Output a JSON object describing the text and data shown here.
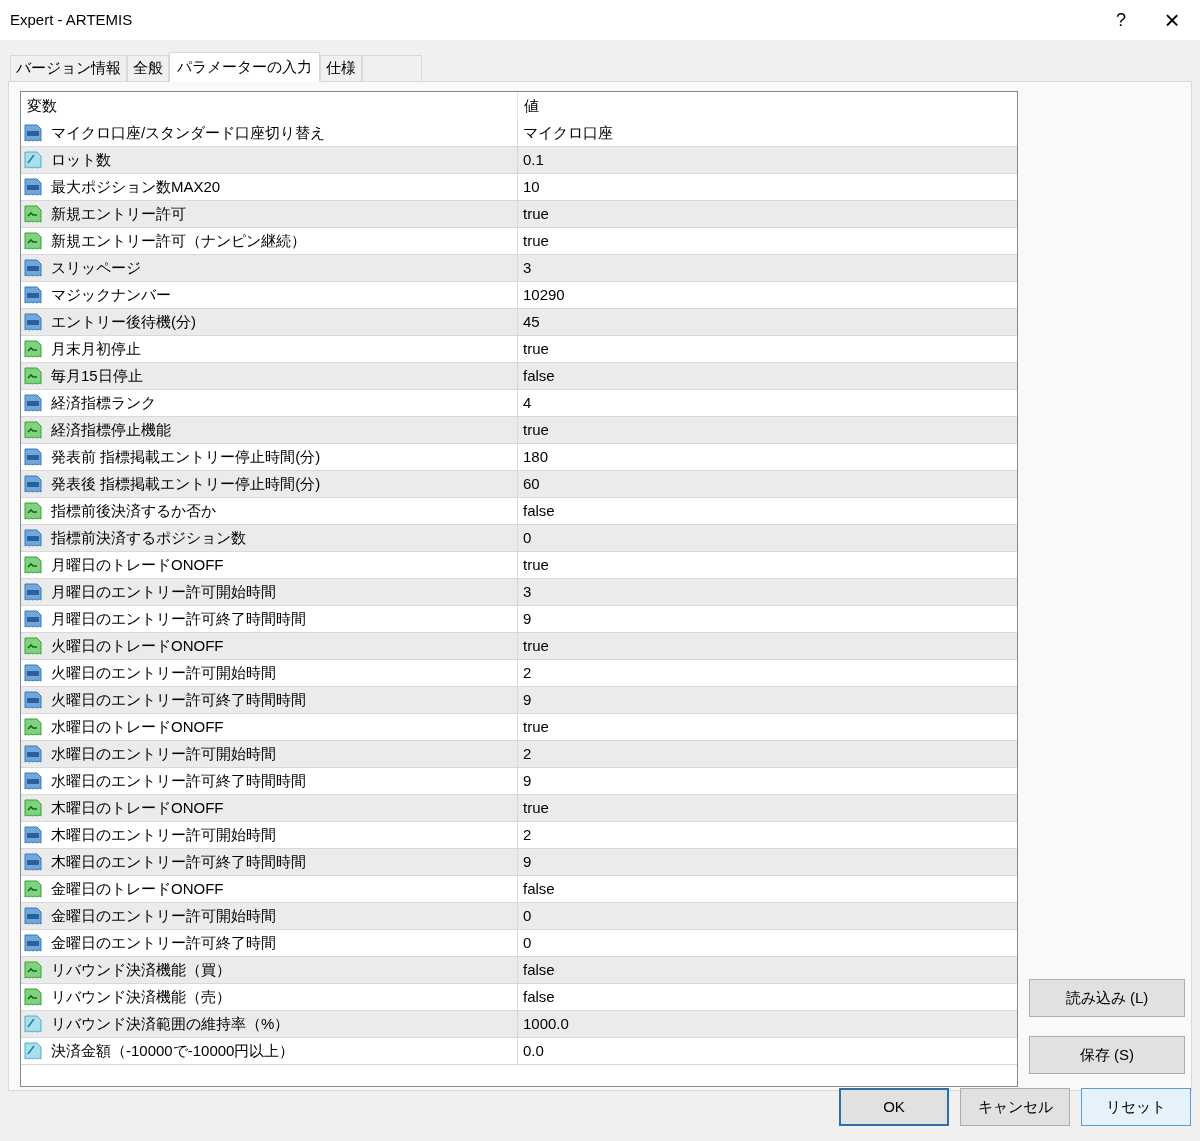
{
  "window": {
    "title": "Expert - ARTEMIS",
    "help": "?",
    "close": "×"
  },
  "tabs": [
    {
      "label": "バージョン情報",
      "selected": false
    },
    {
      "label": "全般",
      "selected": false
    },
    {
      "label": "パラメーターの入力",
      "selected": true
    },
    {
      "label": "仕様",
      "selected": false
    }
  ],
  "table": {
    "columns": [
      "変数",
      "値"
    ],
    "rows": [
      {
        "kind": "int",
        "name": "マイクロ口座/スタンダード口座切り替え",
        "value": "マイクロ口座"
      },
      {
        "kind": "double",
        "name": "ロット数",
        "value": "0.1"
      },
      {
        "kind": "int",
        "name": "最大ポジション数MAX20",
        "value": "10"
      },
      {
        "kind": "bool",
        "name": "新規エントリー許可",
        "value": "true"
      },
      {
        "kind": "bool",
        "name": "新規エントリー許可（ナンピン継続）",
        "value": "true"
      },
      {
        "kind": "int",
        "name": "スリッページ",
        "value": "3"
      },
      {
        "kind": "int",
        "name": "マジックナンバー",
        "value": "10290"
      },
      {
        "kind": "int",
        "name": "エントリー後待機(分)",
        "value": "45"
      },
      {
        "kind": "bool",
        "name": "月末月初停止",
        "value": "true"
      },
      {
        "kind": "bool",
        "name": "毎月15日停止",
        "value": "false"
      },
      {
        "kind": "int",
        "name": "経済指標ランク",
        "value": "4"
      },
      {
        "kind": "bool",
        "name": "経済指標停止機能",
        "value": "true"
      },
      {
        "kind": "int",
        "name": "発表前 指標掲載エントリー停止時間(分)",
        "value": "180"
      },
      {
        "kind": "int",
        "name": "発表後 指標掲載エントリー停止時間(分)",
        "value": "60"
      },
      {
        "kind": "bool",
        "name": "指標前後決済するか否か",
        "value": "false"
      },
      {
        "kind": "int",
        "name": "指標前決済するポジション数",
        "value": "0"
      },
      {
        "kind": "bool",
        "name": "月曜日のトレードONOFF",
        "value": "true"
      },
      {
        "kind": "int",
        "name": "月曜日のエントリー許可開始時間",
        "value": "3"
      },
      {
        "kind": "int",
        "name": "月曜日のエントリー許可終了時間時間",
        "value": "9"
      },
      {
        "kind": "bool",
        "name": "火曜日のトレードONOFF",
        "value": "true"
      },
      {
        "kind": "int",
        "name": "火曜日のエントリー許可開始時間",
        "value": "2"
      },
      {
        "kind": "int",
        "name": "火曜日のエントリー許可終了時間時間",
        "value": "9"
      },
      {
        "kind": "bool",
        "name": "水曜日のトレードONOFF",
        "value": "true"
      },
      {
        "kind": "int",
        "name": "水曜日のエントリー許可開始時間",
        "value": "2"
      },
      {
        "kind": "int",
        "name": "水曜日のエントリー許可終了時間時間",
        "value": "9"
      },
      {
        "kind": "bool",
        "name": "木曜日のトレードONOFF",
        "value": "true"
      },
      {
        "kind": "int",
        "name": "木曜日のエントリー許可開始時間",
        "value": "2"
      },
      {
        "kind": "int",
        "name": "木曜日のエントリー許可終了時間時間",
        "value": "9"
      },
      {
        "kind": "bool",
        "name": "金曜日のトレードONOFF",
        "value": "false"
      },
      {
        "kind": "int",
        "name": "金曜日のエントリー許可開始時間",
        "value": "0"
      },
      {
        "kind": "int",
        "name": "金曜日のエントリー許可終了時間",
        "value": "0"
      },
      {
        "kind": "bool",
        "name": "リバウンド決済機能（買）",
        "value": "false"
      },
      {
        "kind": "bool",
        "name": "リバウンド決済機能（売）",
        "value": "false"
      },
      {
        "kind": "double",
        "name": "リバウンド決済範囲の維持率（%）",
        "value": "1000.0"
      },
      {
        "kind": "double",
        "name": "決済金額（-10000で-10000円以上）",
        "value": "0.0"
      }
    ]
  },
  "side_buttons": [
    {
      "label": "読み込み (L)"
    },
    {
      "label": "保存 (S)"
    }
  ],
  "buttons": [
    {
      "label": "OK",
      "kind": "default"
    },
    {
      "label": "キャンセル",
      "kind": "normal"
    },
    {
      "label": "リセット",
      "kind": "hot"
    }
  ]
}
